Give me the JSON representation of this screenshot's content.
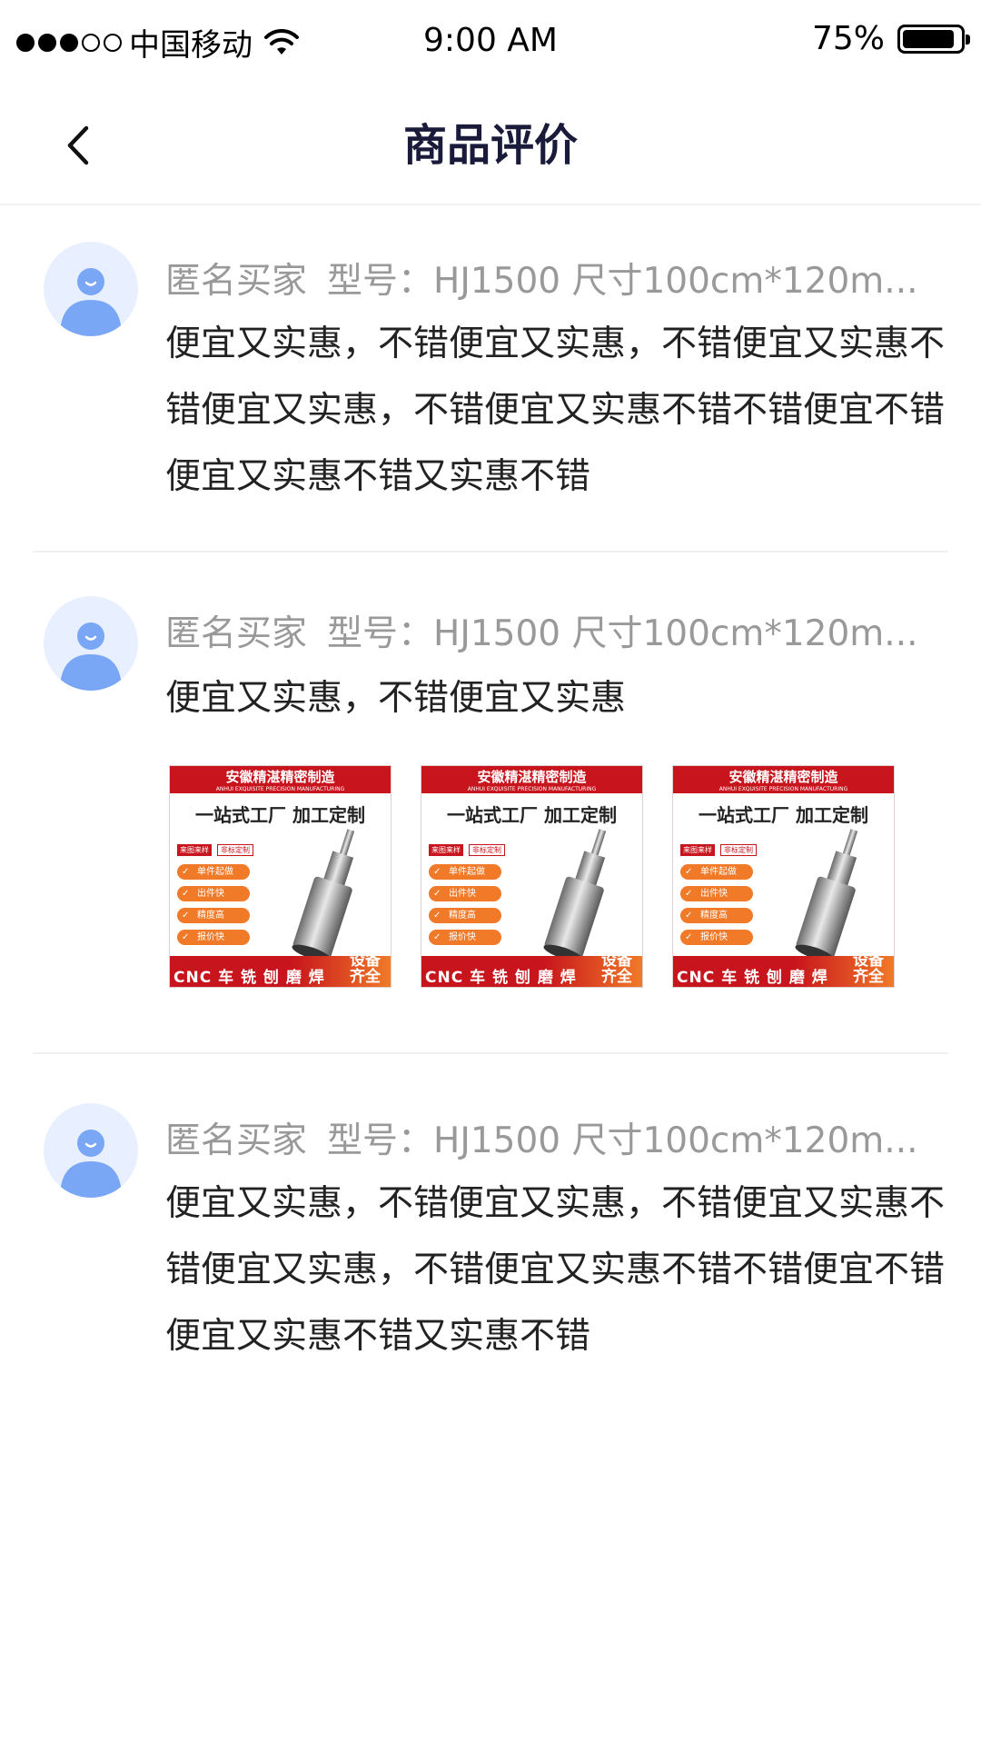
{
  "status_bar": {
    "carrier": "中国移动",
    "time": "9:00 AM",
    "battery_percent": "75%",
    "battery_level": 0.9,
    "signal_dots": [
      true,
      true,
      true,
      false,
      false
    ]
  },
  "header": {
    "title": "商品评价",
    "back_icon": "chevron-left-icon"
  },
  "reviews": [
    {
      "user": "匿名买家",
      "spec": "型号：HJ1500 尺寸100cm*120m...",
      "text": "便宜又实惠，不错便宜又实惠，不错便宜又实惠不错便宜又实惠，不错便宜又实惠不错不错便宜不错便宜又实惠不错又实惠不错",
      "photos": []
    },
    {
      "user": "匿名买家",
      "spec": "型号：HJ1500 尺寸100cm*120m...",
      "text": "便宜又实惠，不错便宜又实惠",
      "photos": [
        {
          "title": "安徽精湛精密制造",
          "subtitle": "ANHUI EXQUISITE PRECISION MANUFACTURING",
          "slogan": "一站式工厂 加工定制",
          "tag1": "来图来样",
          "tag2": "非标定制",
          "features": [
            "单件起做",
            "出件快",
            "精度高",
            "报价快"
          ],
          "bottom": "CNC 车 铣 刨 磨 焊",
          "corner": "设备齐全"
        },
        {
          "title": "安徽精湛精密制造",
          "subtitle": "ANHUI EXQUISITE PRECISION MANUFACTURING",
          "slogan": "一站式工厂 加工定制",
          "tag1": "来图来样",
          "tag2": "非标定制",
          "features": [
            "单件起做",
            "出件快",
            "精度高",
            "报价快"
          ],
          "bottom": "CNC 车 铣 刨 磨 焊",
          "corner": "设备齐全"
        },
        {
          "title": "安徽精湛精密制造",
          "subtitle": "ANHUI EXQUISITE PRECISION MANUFACTURING",
          "slogan": "一站式工厂 加工定制",
          "tag1": "来图来样",
          "tag2": "非标定制",
          "features": [
            "单件起做",
            "出件快",
            "精度高",
            "报价快"
          ],
          "bottom": "CNC 车 铣 刨 磨 焊",
          "corner": "设备齐全"
        }
      ]
    },
    {
      "user": "匿名买家",
      "spec": "型号：HJ1500 尺寸100cm*120m...",
      "text": "便宜又实惠，不错便宜又实惠，不错便宜又实惠不错便宜又实惠，不错便宜又实惠不错不错便宜不错便宜又实惠不错又实惠不错",
      "photos": []
    }
  ],
  "colors": {
    "title": "#1a1a3a",
    "meta_text": "#999999",
    "body_text": "#222222",
    "avatar_bg": "#e8f0ff",
    "avatar_fg": "#7aa7f5",
    "photo_red": "#c8141c",
    "photo_orange": "#f07a28"
  }
}
